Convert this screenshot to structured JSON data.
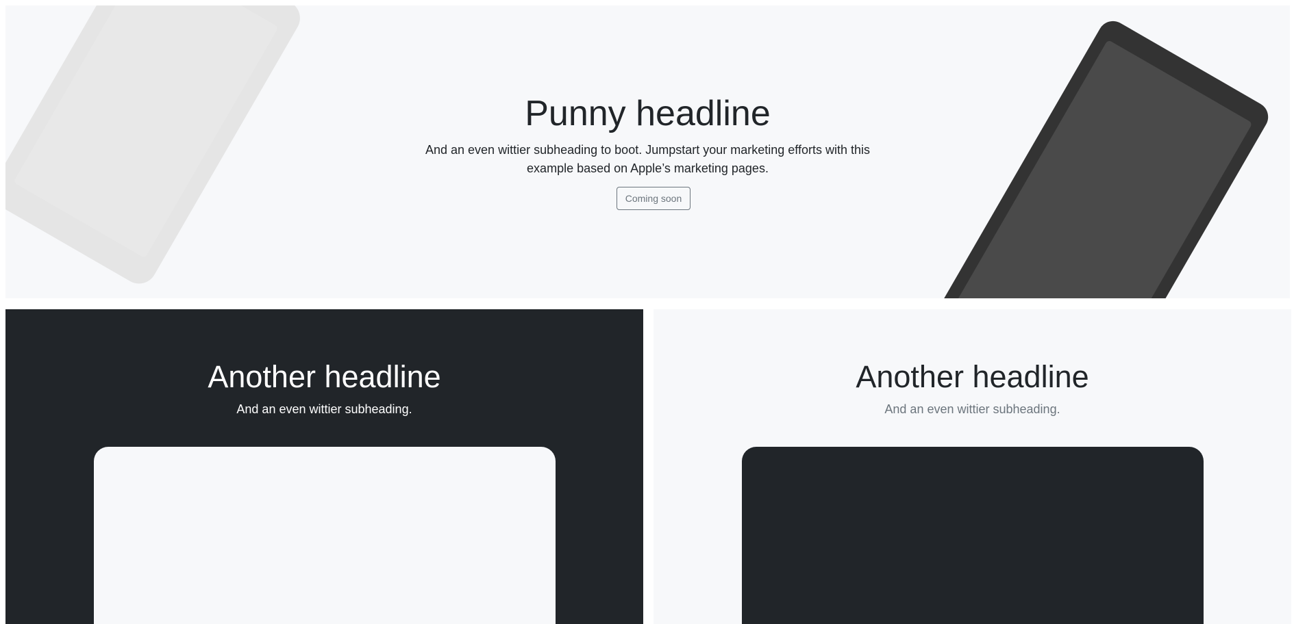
{
  "hero": {
    "title": "Punny headline",
    "subtitle": "And an even wittier subheading to boot. Jumpstart your marketing efforts with this example based on Apple’s marketing pages.",
    "button_label": "Coming soon"
  },
  "panels": [
    {
      "theme": "dark",
      "title": "Another headline",
      "subtitle": "And an even wittier subheading."
    },
    {
      "theme": "light",
      "title": "Another headline",
      "subtitle": "And an even wittier subheading."
    }
  ],
  "colors": {
    "dark": "#212529",
    "light": "#f7f8fa",
    "muted": "#6c757d",
    "device_dark": "#333333",
    "device_light": "#e5e5e5"
  }
}
